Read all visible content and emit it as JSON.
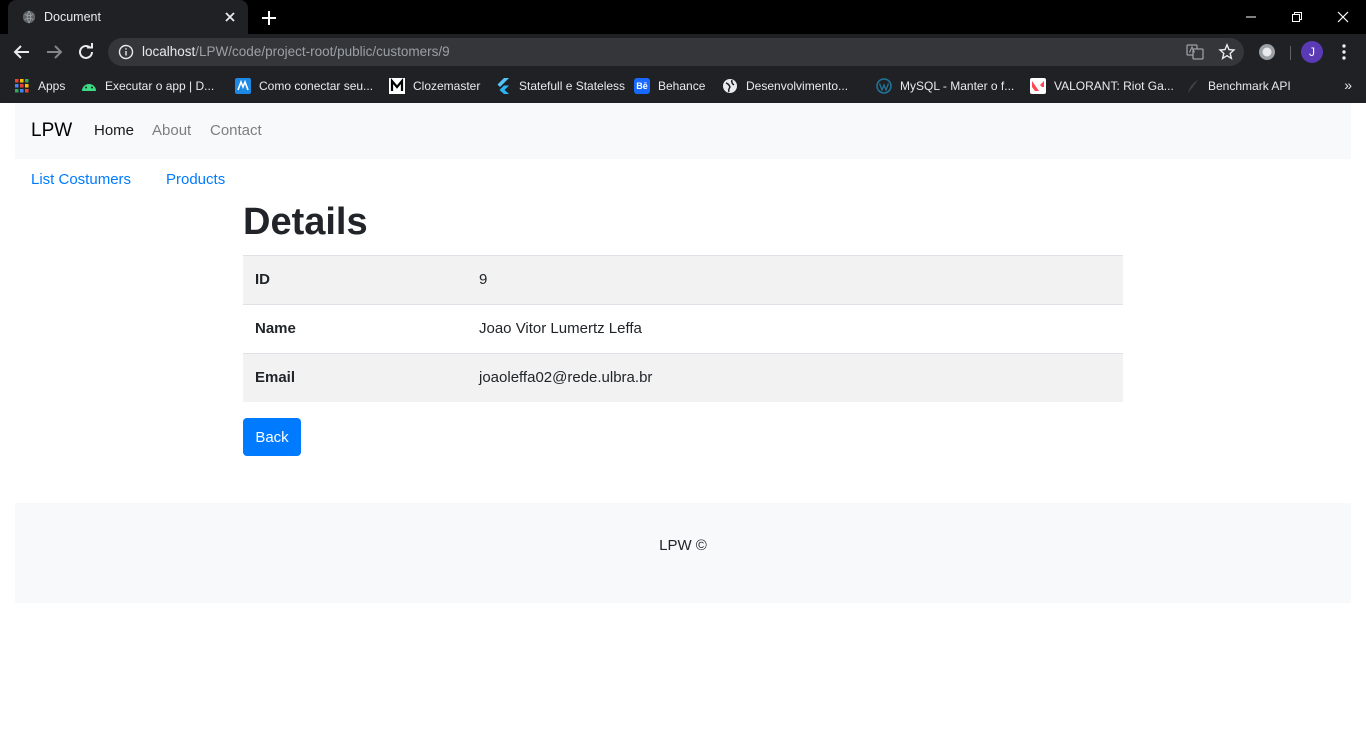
{
  "browser": {
    "tab_title": "Document",
    "url_host": "localhost",
    "url_path": "/LPW/code/project-root/public/customers/9",
    "profile_initial": "J",
    "bookmarks": [
      {
        "label": "Apps",
        "icon": "apps-grid-icon"
      },
      {
        "label": "Executar o app | D...",
        "icon": "android-icon"
      },
      {
        "label": "Como conectar seu...",
        "icon": "bookmark-logo-icon"
      },
      {
        "label": "Clozemaster",
        "icon": "clozemaster-icon"
      },
      {
        "label": "Statefull e Stateless",
        "icon": "flutter-icon"
      },
      {
        "label": "Behance",
        "icon": "behance-icon"
      },
      {
        "label": "Desenvolvimento...",
        "icon": "globe-icon"
      },
      {
        "label": "MySQL - Manter o f...",
        "icon": "wordpress-icon"
      },
      {
        "label": "VALORANT: Riot Ga...",
        "icon": "valorant-icon"
      },
      {
        "label": "Benchmark API",
        "icon": "bookmark-icon"
      }
    ]
  },
  "navbar": {
    "brand": "LPW",
    "links": [
      "Home",
      "About",
      "Contact"
    ]
  },
  "sublinks": [
    "List Costumers",
    "Products"
  ],
  "details": {
    "heading": "Details",
    "rows": [
      {
        "key": "ID",
        "value": "9"
      },
      {
        "key": "Name",
        "value": "Joao Vitor Lumertz Leffa"
      },
      {
        "key": "Email",
        "value": "joaoleffa02@rede.ulbra.br"
      }
    ],
    "back_label": "Back"
  },
  "footer": {
    "text": "LPW ©"
  },
  "colors": {
    "primary": "#007bff",
    "navbar_bg": "#f8f9fa",
    "stripe_bg": "#f2f2f2",
    "chrome_bg": "#202124"
  }
}
